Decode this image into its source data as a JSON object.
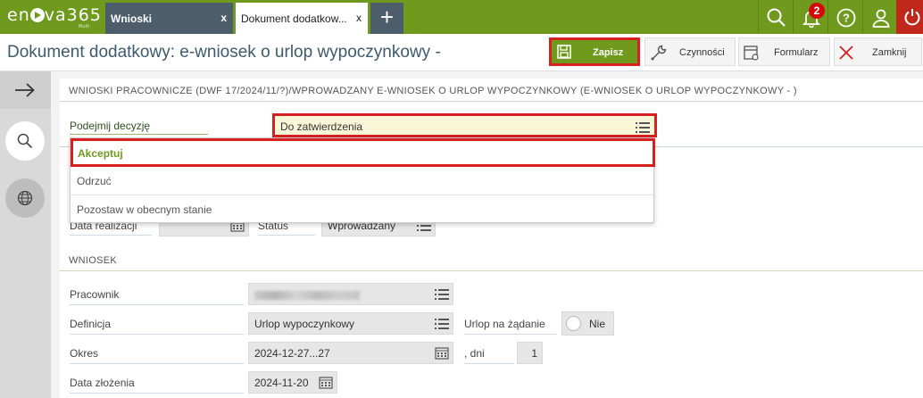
{
  "app": {
    "logo": "en va365",
    "logo_sub": "Multi"
  },
  "tabs": [
    {
      "label": "Wnioski",
      "close": "x"
    },
    {
      "label": "Dokument dodatkow...",
      "close": "x"
    }
  ],
  "topbar": {
    "notifications_count": "2"
  },
  "page": {
    "title": "Dokument dodatkowy: e-wniosek o urlop wypoczynkowy -"
  },
  "toolbar": {
    "save": "Zapisz",
    "actions": "Czynności",
    "form": "Formularz",
    "close": "Zamknij"
  },
  "section1": {
    "header": "WNIOSKI PRACOWNICZE (DWF 17/2024/11/?)/WPROWADZANY E-WNIOSEK O URLOP WYPOCZYNKOWY (E-WNIOSEK O URLOP WYPOCZYNKOWY - )",
    "decision_label": "Podejmij decyzję",
    "decision_value": "Do zatwierdzenia"
  },
  "dropdown": {
    "options": [
      "Akceptuj",
      "Odrzuć",
      "Pozostaw w obecnym stanie"
    ]
  },
  "partial": {
    "date_label": "Data realizacji",
    "status_label": "Status",
    "status_value": "Wprowadzany"
  },
  "section2": {
    "header": "WNIOSEK",
    "employee_label": "Pracownik",
    "definition_label": "Definicja",
    "definition_value": "Urlop wypoczynkowy",
    "on_demand_label": "Urlop na żądanie",
    "on_demand_value": "Nie",
    "period_label": "Okres",
    "period_value": "2024-12-27...27",
    "days_label": ", dni",
    "days_value": "1",
    "filed_label": "Data złożenia",
    "filed_value": "2024-11-20"
  },
  "colors": {
    "brand_green": "#6f9a1d",
    "highlight_red": "#d92020",
    "tab_dark": "#4d5d6b"
  }
}
